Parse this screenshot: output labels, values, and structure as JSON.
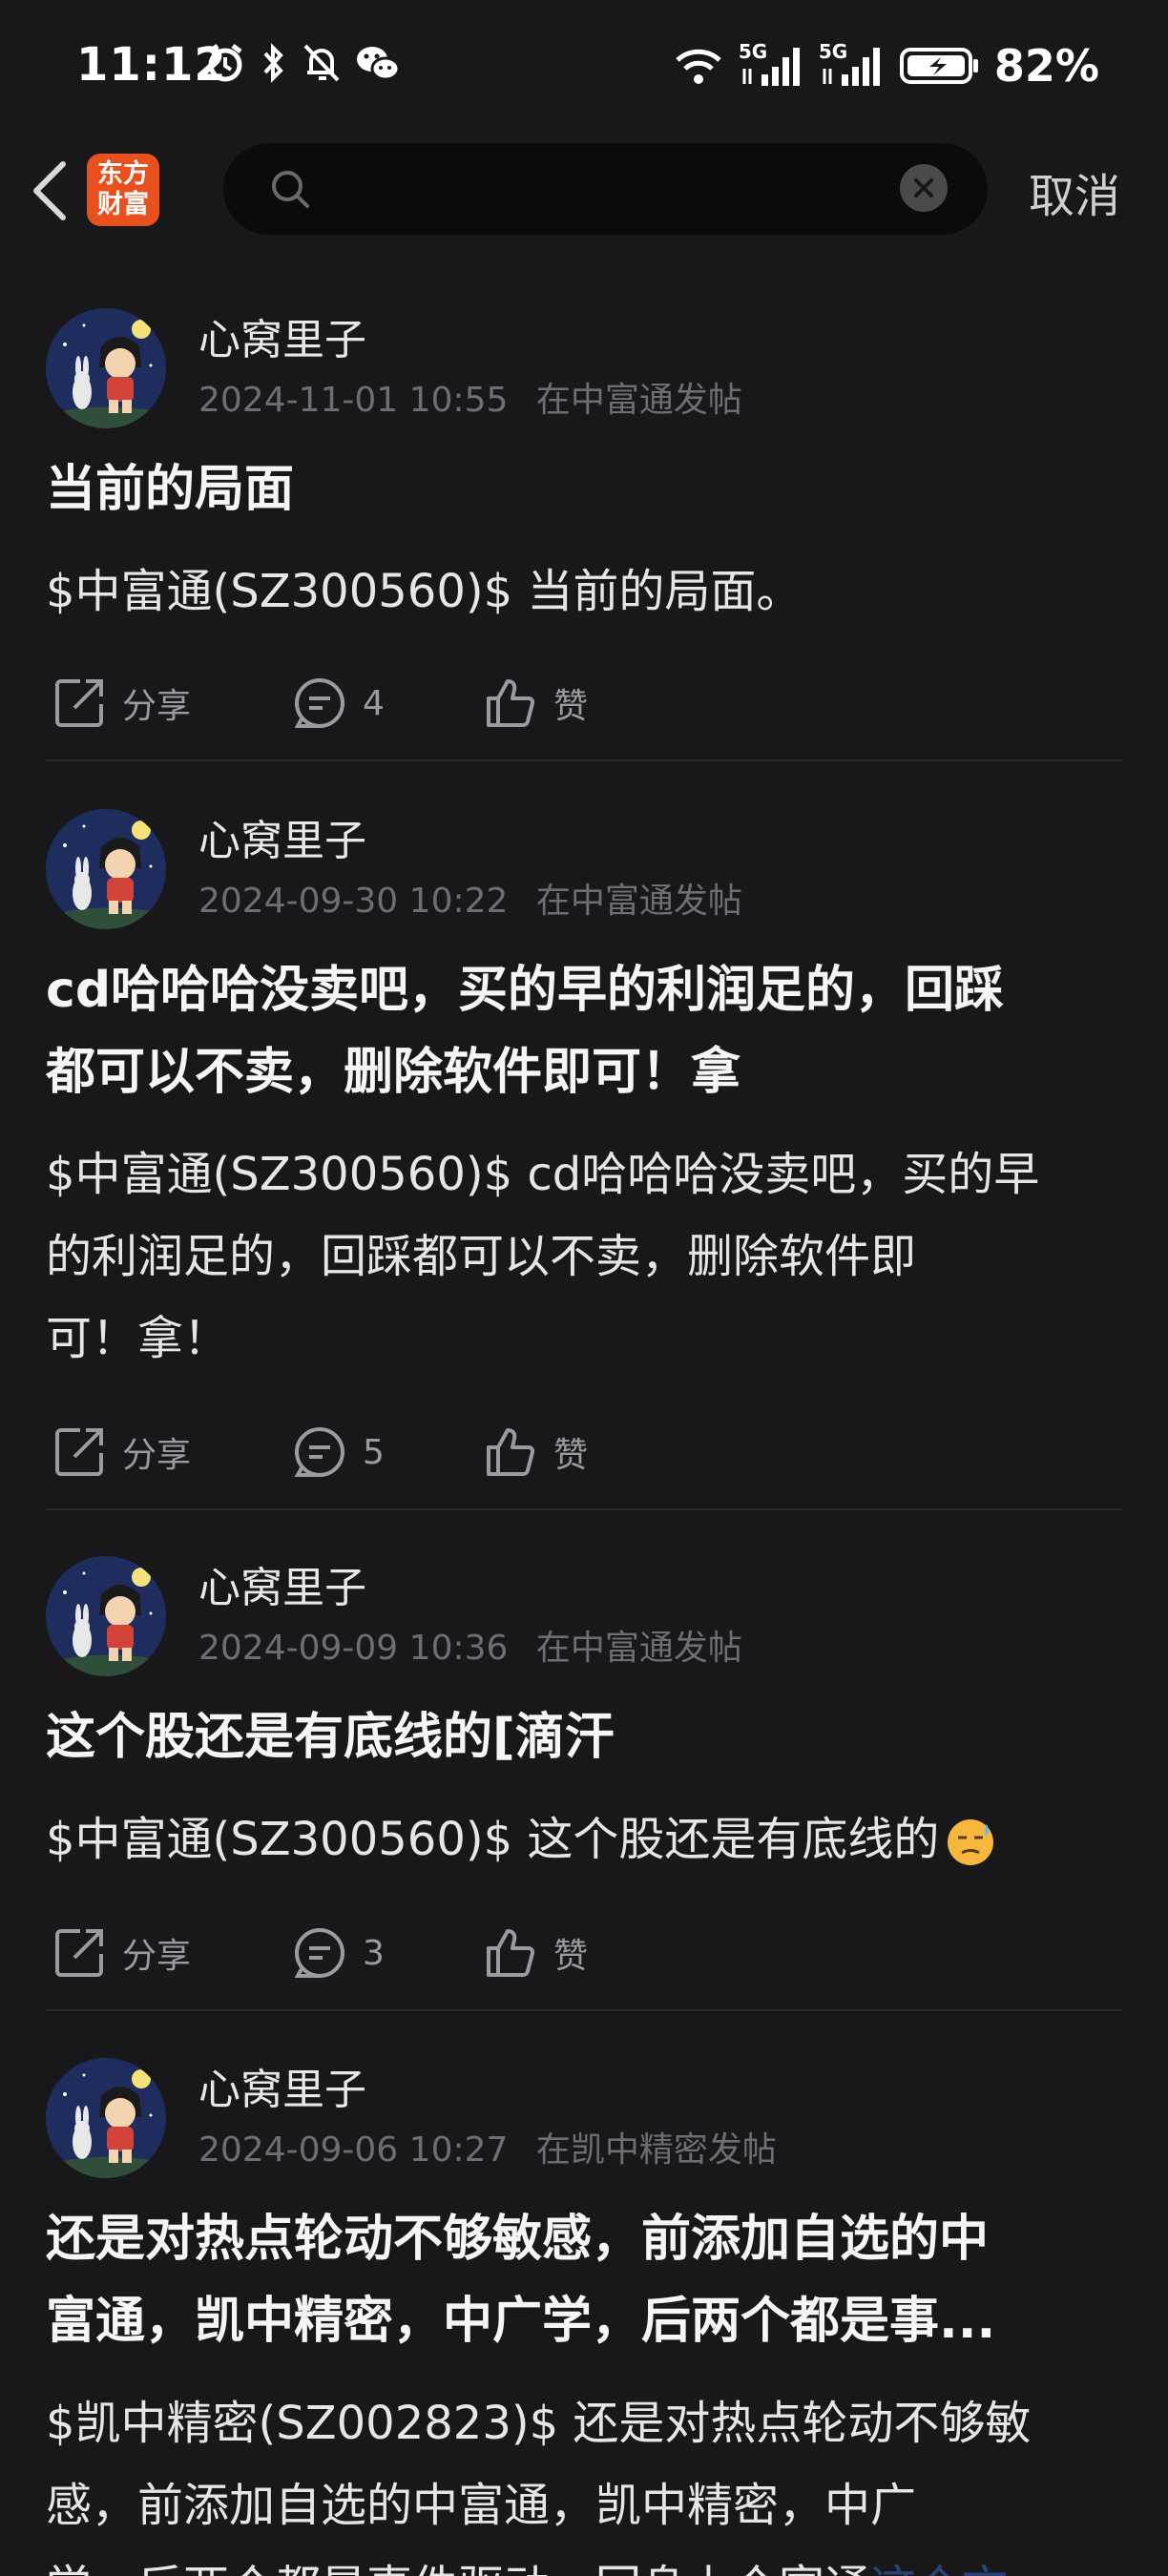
{
  "status_bar": {
    "time": "11:12",
    "battery": "82%",
    "network_1": "5G",
    "network_2": "5G"
  },
  "topbar": {
    "logo_line1": "东方",
    "logo_line2": "财富",
    "search_placeholder": "",
    "cancel_label": "取消"
  },
  "colors": {
    "background": "#18181a",
    "logo": "#e8501e",
    "meta": "#6e6e72",
    "link": "#3b6fd6"
  },
  "posts": [
    {
      "author": "心窝里子",
      "date": "2024-11-01 10:55",
      "source": "在中富通发帖",
      "title": "当前的局面",
      "body": "$中富通(SZ300560)$ 当前的局面。",
      "share": "分享",
      "comments": "4",
      "like": "赞"
    },
    {
      "author": "心窝里子",
      "date": "2024-09-30 10:22",
      "source": "在中富通发帖",
      "title_line1": "cd哈哈哈没卖吧，买的早的利润足的，回踩",
      "title_line2": "都可以不卖，删除软件即可！拿",
      "body_line1": "$中富通(SZ300560)$ cd哈哈哈没卖吧，买的早",
      "body_line2": "的利润足的，回踩都可以不卖，删除软件即",
      "body_line3": "可！拿！",
      "share": "分享",
      "comments": "5",
      "like": "赞"
    },
    {
      "author": "心窝里子",
      "date": "2024-09-09 10:36",
      "source": "在中富通发帖",
      "title": "这个股还是有底线的[滴汗",
      "body": "$中富通(SZ300560)$ 这个股还是有底线的",
      "share": "分享",
      "comments": "3",
      "like": "赞"
    },
    {
      "author": "心窝里子",
      "date": "2024-09-06 10:27",
      "source": "在凯中精密发帖",
      "title_line1": "还是对热点轮动不够敏感，前添加自选的中",
      "title_line2": "富通，凯中精密，中广学，后两个都是事...",
      "body_line1": "$凯中精密(SZ002823)$ 还是对热点轮动不够敏",
      "body_line2": "感，前添加自选的中富通，凯中精密，中广",
      "body_line3": "学，后两个都是事件驱动，回身上个富通",
      "body_link": "这个文"
    }
  ]
}
